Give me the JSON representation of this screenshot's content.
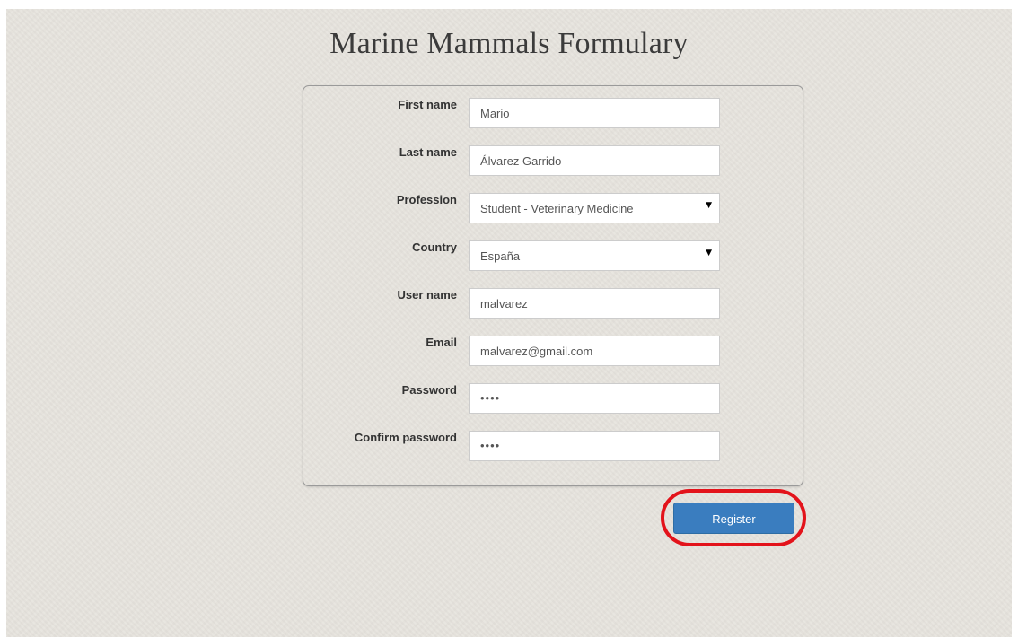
{
  "page": {
    "title": "Marine Mammals Formulary",
    "background_color": "#e6e3dd"
  },
  "form": {
    "fields": [
      {
        "label": "First name",
        "value": "Mario",
        "type": "text"
      },
      {
        "label": "Last name",
        "value": "Álvarez Garrido",
        "type": "text"
      },
      {
        "label": "Profession",
        "value": "Student - Veterinary Medicine",
        "type": "select"
      },
      {
        "label": "Country",
        "value": "España",
        "type": "select"
      },
      {
        "label": "User name",
        "value": "malvarez",
        "type": "text"
      },
      {
        "label": "Email",
        "value": "malvarez@gmail.com",
        "type": "email"
      },
      {
        "label": "Password",
        "value": "••••",
        "type": "password"
      },
      {
        "label": "Confirm password",
        "value": "••••",
        "type": "password"
      }
    ],
    "dropdown_glyph": "▼"
  },
  "actions": {
    "register_label": "Register",
    "button_color": "#3a7dbf",
    "highlight_color": "#e3131b"
  }
}
